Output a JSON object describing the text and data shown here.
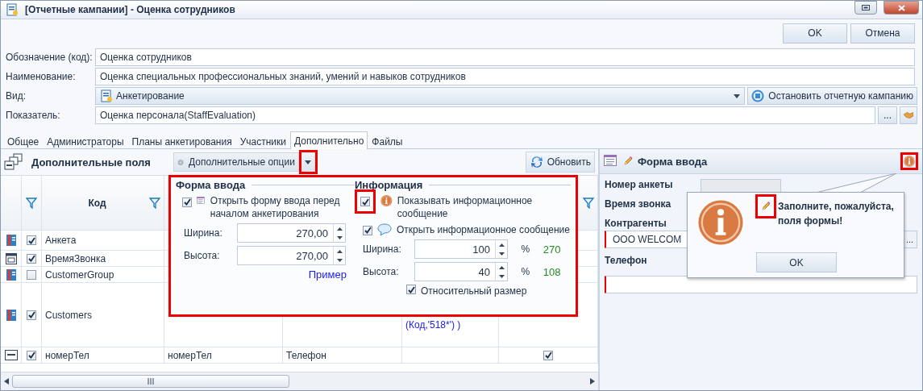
{
  "window": {
    "title": "[Отчетные кампании] - Оценка сотрудников"
  },
  "dialog_buttons": [
    "OK",
    "Отмена"
  ],
  "fields": [
    {
      "kind": "text",
      "label": "Обозначение (код):",
      "value": "Оценка сотрудников"
    },
    {
      "kind": "text",
      "label": "Наименование:",
      "value": "Оценка специальных профессиональных знаний, умений и навыков сотрудников"
    },
    {
      "kind": "dropdown",
      "label": "Вид:",
      "value": "Анкетирование",
      "button": "Остановить отчетную кампанию"
    },
    {
      "kind": "lookup",
      "label": "Показатель:",
      "value": "Оценка персонала(StaffEvaluation)",
      "button": "..."
    }
  ],
  "tabs": [
    {
      "label": "Общее",
      "selected": false
    },
    {
      "label": "Администраторы",
      "selected": false
    },
    {
      "label": "Планы анкетирования",
      "selected": false
    },
    {
      "label": "Участники",
      "selected": false
    },
    {
      "label": "Дополнительно",
      "selected": true
    },
    {
      "label": "Файлы",
      "selected": false
    }
  ],
  "extra_fields": {
    "title": "Дополнительные поля",
    "options_button": {
      "label": "Дополнительные опции",
      "highlighted": true
    },
    "refresh_button": "Обновить",
    "columns": [
      {
        "label": "Код"
      }
    ],
    "rows": [
      {
        "kind": "reference",
        "checked": true,
        "code": "Анкета"
      },
      {
        "kind": "date",
        "checked": true,
        "code": "ВремяЗвонка"
      },
      {
        "kind": "reference",
        "checked": false,
        "code": "CustomerGroup"
      },
      {
        "kind": "reference",
        "checked": true,
        "code": "Customers",
        "column_6": "(Код,'518*') )"
      },
      {
        "kind": "text",
        "checked": true,
        "code": "номерТел",
        "column_4": "номерТел",
        "column_5": "Телефон",
        "column_7_checked": true
      }
    ]
  },
  "options_popup": {
    "highlighted": true,
    "input_form": {
      "title": "Форма ввода",
      "open_before": {
        "label": "Открыть форму ввода перед началом анкетирования",
        "checked": true
      },
      "width": {
        "label": "Ширина:",
        "value": "270,00"
      },
      "height": {
        "label": "Высота:",
        "value": "270,00"
      },
      "link": "Пример"
    },
    "info": {
      "title": "Информация",
      "show_message": {
        "label": "Показывать информационное сообщение",
        "checked": true,
        "highlighted": true
      },
      "open_message": {
        "label": "Открыть информационное сообщение",
        "checked": true
      },
      "width": {
        "label": "Ширина:",
        "value": "100",
        "unit": "%",
        "computed": "270"
      },
      "height": {
        "label": "Высота:",
        "value": "40",
        "unit": "%",
        "computed": "108"
      },
      "relative_size": {
        "label": "Относительный размер",
        "checked": true
      }
    }
  },
  "preview": {
    "title": "Форма ввода",
    "info_button_highlighted": true,
    "fields": [
      {
        "kind": "readonly",
        "label": "Номер анкеты"
      },
      {
        "kind": "hidden",
        "label": "Время звонка"
      },
      {
        "kind": "lookup",
        "label": "Контрагенты",
        "value": "ООО WELCOM",
        "required": true,
        "button": "..."
      },
      {
        "kind": "text",
        "label": "Телефон",
        "required": true
      }
    ],
    "message": {
      "text": "Заполните, пожалуйста, поля формы!",
      "button": "OK",
      "pencil_highlighted": true
    }
  }
}
